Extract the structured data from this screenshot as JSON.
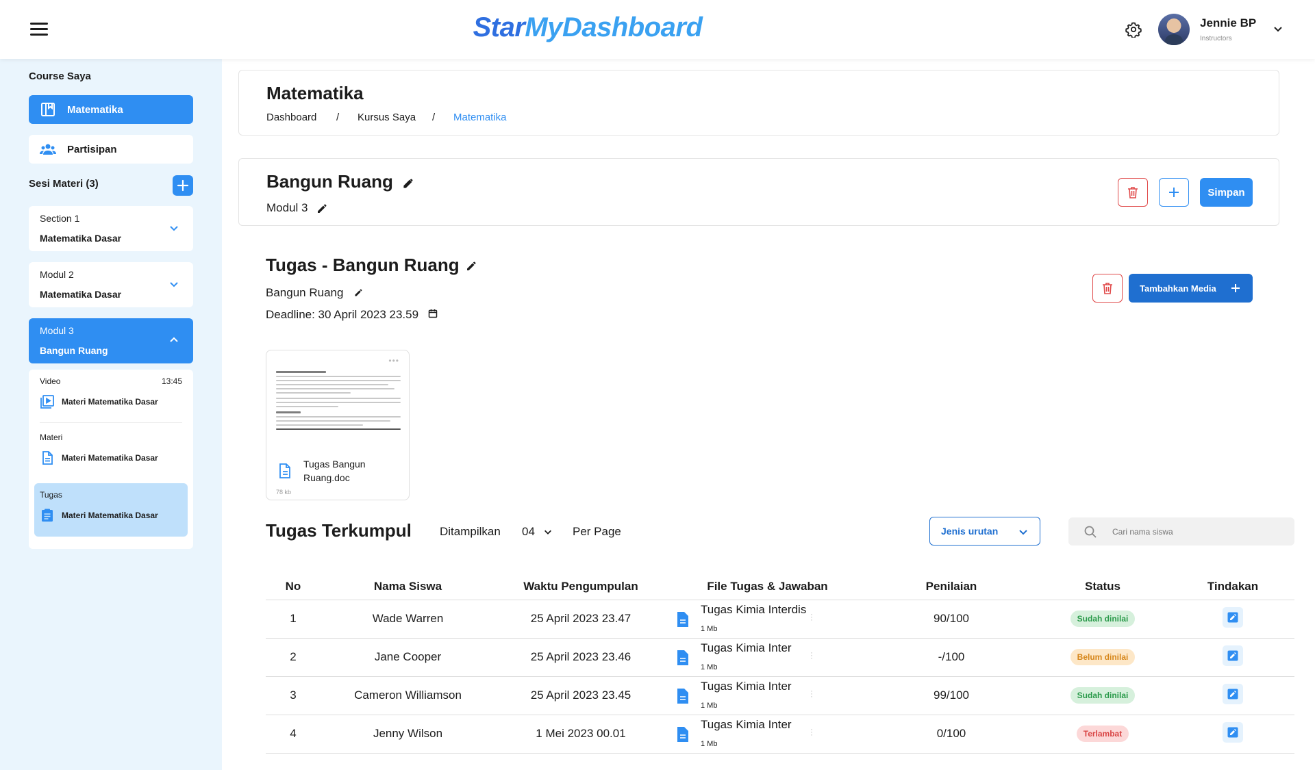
{
  "header": {
    "brand_part1": "Star",
    "brand_part2": "MyDashboard",
    "user_name": "Jennie BP",
    "user_role": "Instructors"
  },
  "sidebar": {
    "course_heading": "Course Saya",
    "course_items": [
      {
        "label": "Matematika",
        "icon": "book-icon",
        "active": true
      },
      {
        "label": "Partisipan",
        "icon": "users-icon",
        "active": false
      }
    ],
    "sessions_heading": "Sesi Materi (3)",
    "sections": [
      {
        "label": "Section 1",
        "title": "Matematika Dasar",
        "expanded": false
      },
      {
        "label": "Modul 2",
        "title": "Matematika Dasar",
        "expanded": false
      },
      {
        "label": "Modul 3",
        "title": "Bangun Ruang",
        "expanded": true
      }
    ],
    "lessons": [
      {
        "type": "Video",
        "duration": "13:45",
        "title": "Materi Matematika Dasar",
        "icon": "video-icon"
      },
      {
        "type": "Materi",
        "title": "Materi Matematika Dasar",
        "icon": "document-icon"
      },
      {
        "type": "Tugas",
        "title": "Materi Matematika Dasar",
        "icon": "assignment-icon",
        "selected": true
      }
    ]
  },
  "page": {
    "title": "Matematika",
    "breadcrumb": [
      "Dashboard",
      "/",
      "Kursus Saya",
      "/",
      "Matematika"
    ]
  },
  "module": {
    "title": "Bangun Ruang",
    "subtitle": "Modul 3",
    "save_label": "Simpan"
  },
  "assignment": {
    "title": "Tugas - Bangun Ruang",
    "subtitle": "Bangun Ruang",
    "deadline": "Deadline: 30 April 2023 23.59",
    "add_media_label": "Tambahkan Media",
    "attachment": {
      "name": "Tugas Bangun Ruang.doc",
      "size": "78 kb"
    }
  },
  "submissions": {
    "title": "Tugas Terkumpul",
    "shown_label": "Ditampilkan",
    "per_page_value": "04",
    "per_page_label": "Per Page",
    "sort_label": "Jenis urutan",
    "search_placeholder": "Cari nama siswa",
    "columns": [
      "No",
      "Nama Siswa",
      "Waktu Pengumpulan",
      "File Tugas & Jawaban",
      "Penilaian",
      "Status",
      "Tindakan"
    ],
    "rows": [
      {
        "no": "1",
        "name": "Wade Warren",
        "time": "25 April 2023 23.47",
        "file": "Tugas Kimia Interdis",
        "size": "1 Mb",
        "score": "90/100",
        "status": "Sudah dinilai",
        "status_kind": "ok"
      },
      {
        "no": "2",
        "name": "Jane Cooper",
        "time": "25 April 2023 23.46",
        "file": "Tugas Kimia Inter",
        "size": "1 Mb",
        "score": "-/100",
        "status": "Belum dinilai",
        "status_kind": "wait"
      },
      {
        "no": "3",
        "name": "Cameron Williamson",
        "time": "25 April 2023 23.45",
        "file": "Tugas Kimia Inter",
        "size": "1 Mb",
        "score": "99/100",
        "status": "Sudah dinilai",
        "status_kind": "ok"
      },
      {
        "no": "4",
        "name": "Jenny Wilson",
        "time": "1 Mei 2023 00.01",
        "file": "Tugas Kimia Inter",
        "size": "1 Mb",
        "score": "0/100",
        "status": "Terlambat",
        "status_kind": "late"
      }
    ]
  },
  "colors": {
    "primary": "#2f8ef2",
    "primary_dark": "#1f6fd0",
    "sidebar_bg": "#eaf5fd",
    "danger": "#e04848"
  }
}
